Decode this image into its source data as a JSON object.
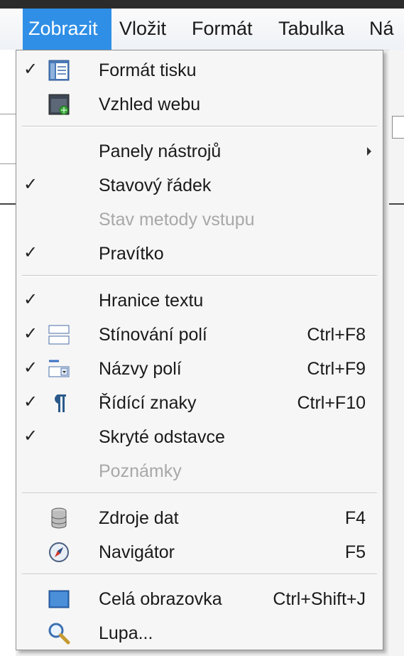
{
  "menubar": {
    "items": [
      {
        "label": "Zobrazit"
      },
      {
        "label": "Vložit"
      },
      {
        "label": "Formát"
      },
      {
        "label": "Tabulka"
      },
      {
        "label": "Ná"
      }
    ]
  },
  "menu": {
    "items": [
      {
        "label": "Formát tisku",
        "checked": "✓",
        "icon": "print-layout-icon"
      },
      {
        "label": "Vzhled webu",
        "checked": "",
        "icon": "web-layout-icon"
      },
      {
        "label": "Panely nástrojů",
        "checked": "",
        "submenu": true
      },
      {
        "label": "Stavový řádek",
        "checked": "✓"
      },
      {
        "label": "Stav metody vstupu",
        "checked": "",
        "disabled": true
      },
      {
        "label": "Pravítko",
        "checked": "✓"
      },
      {
        "label": "Hranice textu",
        "checked": "✓"
      },
      {
        "label": "Stínování polí",
        "checked": "✓",
        "icon": "field-shading-icon",
        "shortcut": "Ctrl+F8"
      },
      {
        "label": "Názvy polí",
        "checked": "✓",
        "icon": "field-names-icon",
        "shortcut": "Ctrl+F9"
      },
      {
        "label": "Řídící znaky",
        "checked": "✓",
        "icon": "pilcrow-icon",
        "shortcut": "Ctrl+F10"
      },
      {
        "label": "Skryté odstavce",
        "checked": "✓"
      },
      {
        "label": "Poznámky",
        "checked": "",
        "disabled": true
      },
      {
        "label": "Zdroje dat",
        "checked": "",
        "icon": "database-icon",
        "shortcut": "F4"
      },
      {
        "label": "Navigátor",
        "checked": "",
        "icon": "navigator-compass-icon",
        "shortcut": "F5"
      },
      {
        "label": "Celá obrazovka",
        "checked": "",
        "icon": "full-screen-icon",
        "shortcut": "Ctrl+Shift+J"
      },
      {
        "label": "Lupa...",
        "checked": "",
        "icon": "magnifier-icon"
      }
    ]
  },
  "colors": {
    "accent": "#2f8fe6",
    "disabled_text": "#a8a8a8",
    "menu_bg": "#f6f6f6"
  }
}
